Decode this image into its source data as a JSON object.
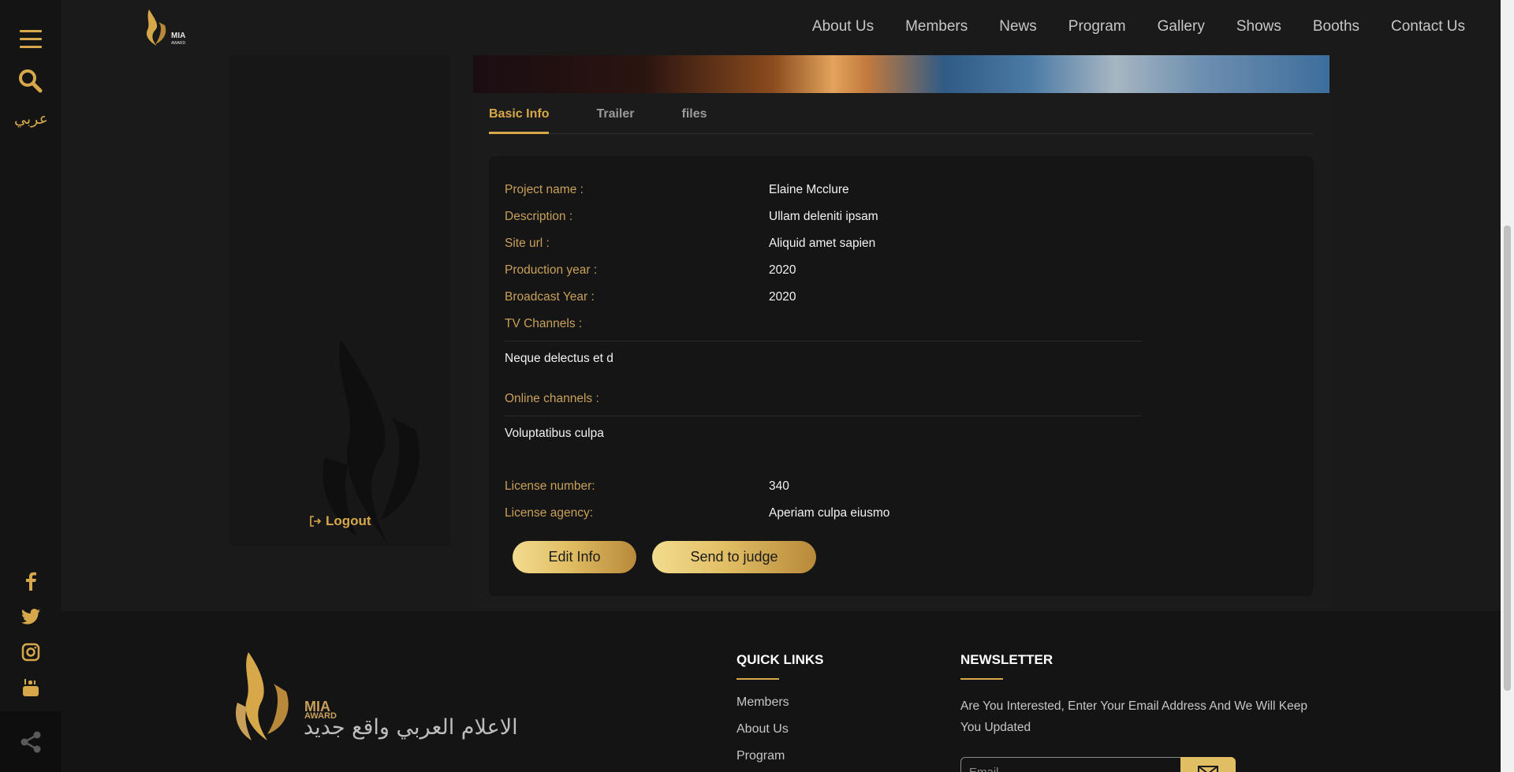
{
  "rail": {
    "lang_label": "عربي"
  },
  "nav": {
    "items": [
      "About Us",
      "Members",
      "News",
      "Program",
      "Gallery",
      "Shows",
      "Booths",
      "Contact Us"
    ]
  },
  "brand": {
    "small_logo_text": "MIA",
    "small_logo_sub": "AWARD",
    "accent": "#d6a84a"
  },
  "sidebar": {
    "logout_label": "Logout"
  },
  "tabs": [
    "Basic Info",
    "Trailer",
    "files"
  ],
  "info": {
    "project_name_label": "Project name :",
    "project_name": "Elaine Mcclure",
    "description_label": "Description :",
    "description": "Ullam deleniti ipsam",
    "site_url_label": "Site url :",
    "site_url": "Aliquid amet sapien",
    "production_year_label": "Production year :",
    "production_year": "2020",
    "broadcast_year_label": "Broadcast Year :",
    "broadcast_year": "2020",
    "tv_channels_label": "TV Channels :",
    "tv_channels": "Neque delectus et d",
    "online_channels_label": "Online channels :",
    "online_channels": "Voluptatibus culpa",
    "license_number_label": "License number:",
    "license_number": "340",
    "license_agency_label": "License agency:",
    "license_agency": "Aperiam culpa eiusmo"
  },
  "actions": {
    "edit_label": "Edit Info",
    "send_label": "Send to judge"
  },
  "footer": {
    "mia": "MIA",
    "award": "AWARD",
    "slogan": "الاعلام العربي واقع جديد",
    "quick_links_title": "QUICK LINKS",
    "quick_links": [
      "Members",
      "About Us",
      "Program"
    ],
    "newsletter_title": "NEWSLETTER",
    "newsletter_text": "Are You Interested, Enter Your Email Address And We Will Keep You Updated",
    "email_placeholder": "Email"
  }
}
